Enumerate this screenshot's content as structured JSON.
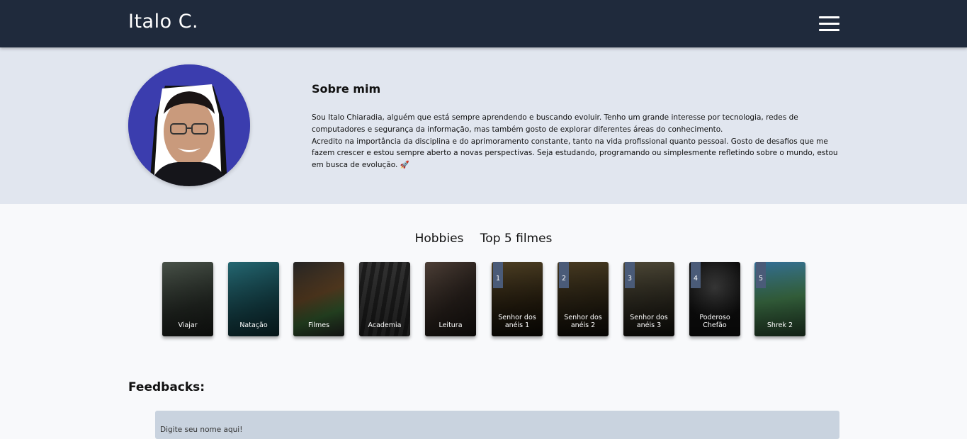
{
  "navbar": {
    "brand": "Italo C.",
    "menu_icon": "hamburger-menu-icon"
  },
  "about": {
    "title": "Sobre mim",
    "paragraph1": "Sou Italo Chiaradia, alguém que está sempre aprendendo e buscando evoluir. Tenho um grande interesse por tecnologia, redes de computadores e segurança da informação, mas também gosto de explorar diferentes áreas do conhecimento.",
    "paragraph2": "Acredito na importância da disciplina e do aprimoramento constante, tanto na vida profissional quanto pessoal. Gosto de desafios que me fazem crescer e estou sempre aberto a novas perspectivas. Seja estudando, programando ou simplesmente refletindo sobre o mundo, estou em busca de evolução. 🚀",
    "avatar_bg_color": "#3b3dae"
  },
  "tabs": [
    "Hobbies",
    "Top 5 filmes"
  ],
  "hobbies": [
    {
      "label": "Viajar",
      "color": "#3a3f3a"
    },
    {
      "label": "Natação",
      "color": "#1d5560"
    },
    {
      "label": "Filmes",
      "color": "#4a3a2a"
    },
    {
      "label": "Academia",
      "color": "#2b2b2b"
    },
    {
      "label": "Leitura",
      "color": "#3a2e26"
    }
  ],
  "movies": [
    {
      "rank": "1",
      "label": "Senhor dos anéis 1",
      "color": "#3a3020"
    },
    {
      "rank": "2",
      "label": "Senhor dos anéis 2",
      "color": "#35301e"
    },
    {
      "rank": "3",
      "label": "Senhor dos anéis 3",
      "color": "#2f2c22"
    },
    {
      "rank": "4",
      "label": "Poderoso Chefão",
      "color": "#1a1a1a"
    },
    {
      "rank": "5",
      "label": "Shrek 2",
      "color": "#3b6a4a"
    }
  ],
  "feedback": {
    "title": "Feedbacks:",
    "name_placeholder": "Digite seu nome aqui!"
  }
}
